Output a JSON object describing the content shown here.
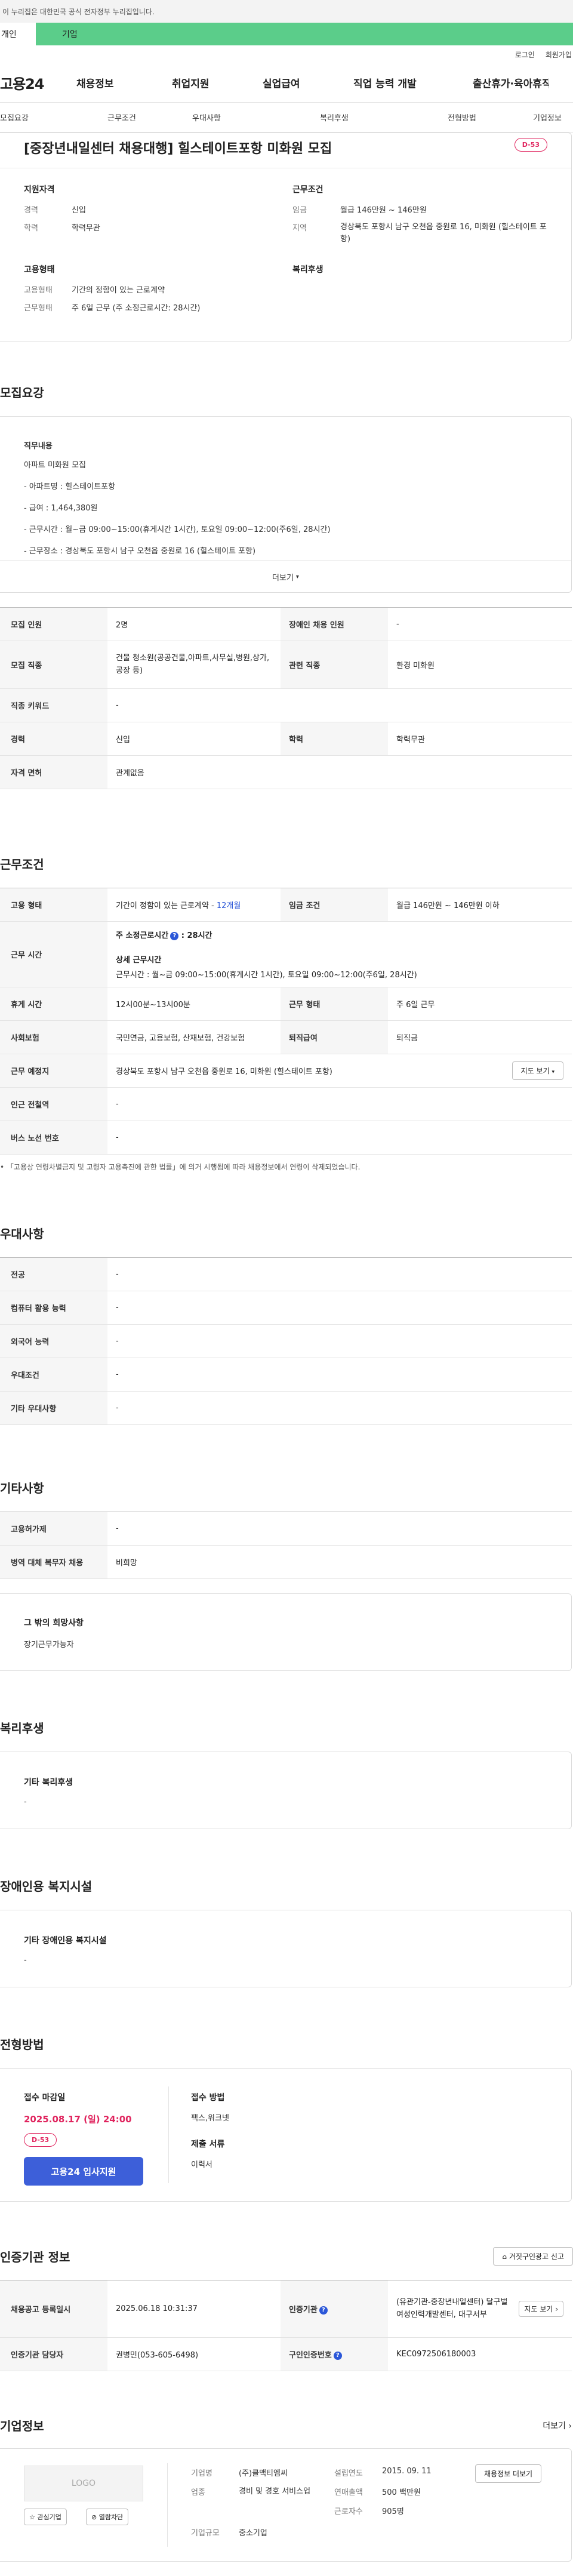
{
  "notice": "이 누리집은 대한민국 공식 전자정부 누리집입니다.",
  "tabs": {
    "personal": "개인",
    "company": "기업"
  },
  "util": {
    "login": "로그인",
    "join": "회원가입"
  },
  "logo": "고용24",
  "gnb": [
    "채용정보",
    "취업지원",
    "실업급여",
    "직업 능력 개발",
    "출산휴가·육아휴직"
  ],
  "subnav": [
    "모집요강",
    "근무조건",
    "우대사항",
    "복리후생",
    "전형방법",
    "기업정보"
  ],
  "summary": {
    "title": "[중장년내일센터 채용대행] 힐스테이트포항 미화원 모집",
    "dday": "D-53",
    "qual_title": "지원자격",
    "career_k": "경력",
    "career_v": "신입",
    "edu_k": "학력",
    "edu_v": "학력무관",
    "cond_title": "근무조건",
    "wage_k": "임금",
    "wage_v": "월급 146만원 ~ 146만원",
    "region_k": "지역",
    "region_v": "경상북도 포항시 남구 오천읍 중원로 16, 미화원 (힐스테이트 포항)",
    "emp_title": "고용형태",
    "emptype_k": "고용형태",
    "emptype_v": "기간의 정함이 있는 근로계약",
    "worktype_k": "근무형태",
    "worktype_v": "주 6일 근무 (주 소정근로시간: 28시간)",
    "welfare_title": "복리후생"
  },
  "recruit": {
    "title": "모집요강",
    "job_desc_label": "직무내용",
    "lines": [
      "아파트 미화원 모집",
      "- 아파트명 : 힐스테이트포항",
      "- 급여 : 1,464,380원",
      "- 근무시간 : 월~금 09:00~15:00(휴게시간 1시간), 토요일 09:00~12:00(주6일, 28시간)",
      "- 근무장소 : 경상북도 포항시 남구 오천읍 중원로 16 (힐스테이트 포항)"
    ],
    "more": "더보기",
    "rows": [
      {
        "k1": "모집 인원",
        "v1": "2명",
        "k2": "장애인 채용 인원",
        "v2": "-"
      },
      {
        "k1": "모집 직종",
        "v1": "건물 청소원(공공건물,아파트,사무실,병원,상가,공장 등)",
        "k2": "관련 직종",
        "v2": "환경 미화원"
      },
      {
        "k1": "직종 키워드",
        "v1": "-"
      },
      {
        "k1": "경력",
        "v1": "신입",
        "k2": "학력",
        "v2": "학력무관"
      },
      {
        "k1": "자격 면허",
        "v1": "관계없음"
      }
    ]
  },
  "conditions": {
    "title": "근무조건",
    "emptype_k": "고용 형태",
    "emptype_v": "기간이 정함이 있는 근로계약 -",
    "emptype_months": "12개월",
    "wage_k": "임금 조건",
    "wage_v": "월급 146만원 ~ 146만원 이하",
    "worktime_k": "근무 시간",
    "worktime_weekly_label": "주 소정근로시간",
    "worktime_weekly_v": ": 28시간",
    "worktime_detail_label": "상세 근무시간",
    "worktime_detail_v": "근무시간 : 월~금 09:00~15:00(휴게시간 1시간), 토요일 09:00~12:00(주6일, 28시간)",
    "rest_k": "휴게 시간",
    "rest_v": "12시00분~13시00분",
    "form_k": "근무 형태",
    "form_v": "주 6일 근무",
    "insurance_k": "사회보험",
    "insurance_v": "국민연금, 고용보험, 산재보험, 건강보험",
    "retire_k": "퇴직급여",
    "retire_v": "퇴직금",
    "place_k": "근무 예정지",
    "place_v": "경상북도 포항시 남구 오천읍 중원로 16, 미화원 (힐스테이트 포항)",
    "map_btn": "지도 보기",
    "subway_k": "인근 전철역",
    "subway_v": "-",
    "bus_k": "버스 노선 번호",
    "bus_v": "-",
    "note": "「고용상 연령차별금지 및 고령자 고용촉진에 관한 법률」에 의거 시행됨에 따라 채용정보에서 연령이 삭제되었습니다."
  },
  "preference": {
    "title": "우대사항",
    "rows": [
      {
        "k": "전공",
        "v": "-"
      },
      {
        "k": "컴퓨터 활용 능력",
        "v": "-"
      },
      {
        "k": "외국어 능력",
        "v": "-"
      },
      {
        "k": "우대조건",
        "v": "-"
      },
      {
        "k": "기타 우대사항",
        "v": "-"
      }
    ]
  },
  "etc": {
    "title": "기타사항",
    "rows": [
      {
        "k": "고용허가제",
        "v": "-"
      },
      {
        "k": "병역 대체 복무자 채용",
        "v": "비희망"
      }
    ],
    "other_title": "그 밖의 희망사항",
    "other_v": "장기근무가능자"
  },
  "welfare": {
    "title": "복리후생",
    "label": "기타 복리후생",
    "value": "-"
  },
  "disabled": {
    "title": "장애인용 복지시설",
    "label": "기타 장애인용 복지시설",
    "value": "-"
  },
  "selection": {
    "title": "전형방법",
    "deadline_label": "접수 마감일",
    "deadline": "2025.08.17 (일) 24:00",
    "dday": "D-53",
    "apply": "고용24 입사지원",
    "method_label": "접수 방법",
    "method_v": "팩스,워크넷",
    "docs_label": "제출 서류",
    "docs_v": "이력서"
  },
  "cert": {
    "title": "인증기관 정보",
    "false_ad": "거짓구인광고 신고",
    "reg_k": "채용공고 등록일시",
    "reg_v": "2025.06.18 10:31:37",
    "org_k": "인증기관",
    "org_v": "(유관기관-중장년내일센터) 달구벌여성인력개발센터, 대구서부",
    "map_btn": "지도 보기",
    "mgr_k": "인증기관 담당자",
    "mgr_v": "권병민(053-605-6498)",
    "cert_no_k": "구인인증번호",
    "cert_no_v": "KEC0972506180003"
  },
  "company": {
    "title": "기업정보",
    "more": "더보기",
    "logo": "LOGO",
    "fav": "관심기업",
    "block": "열람차단",
    "name_k": "기업명",
    "name_v": "(주)클맥티엠씨",
    "industry_k": "업종",
    "industry_v": "경비 및 경호 서비스업",
    "size_k": "기업규모",
    "size_v": "중소기업",
    "founded_k": "설립연도",
    "founded_v": "2015. 09. 11",
    "revenue_k": "연매출액",
    "revenue_v": "500 백만원",
    "employees_k": "근로자수",
    "employees_v": "905명",
    "jobs_btn": "채용정보 더보기"
  }
}
